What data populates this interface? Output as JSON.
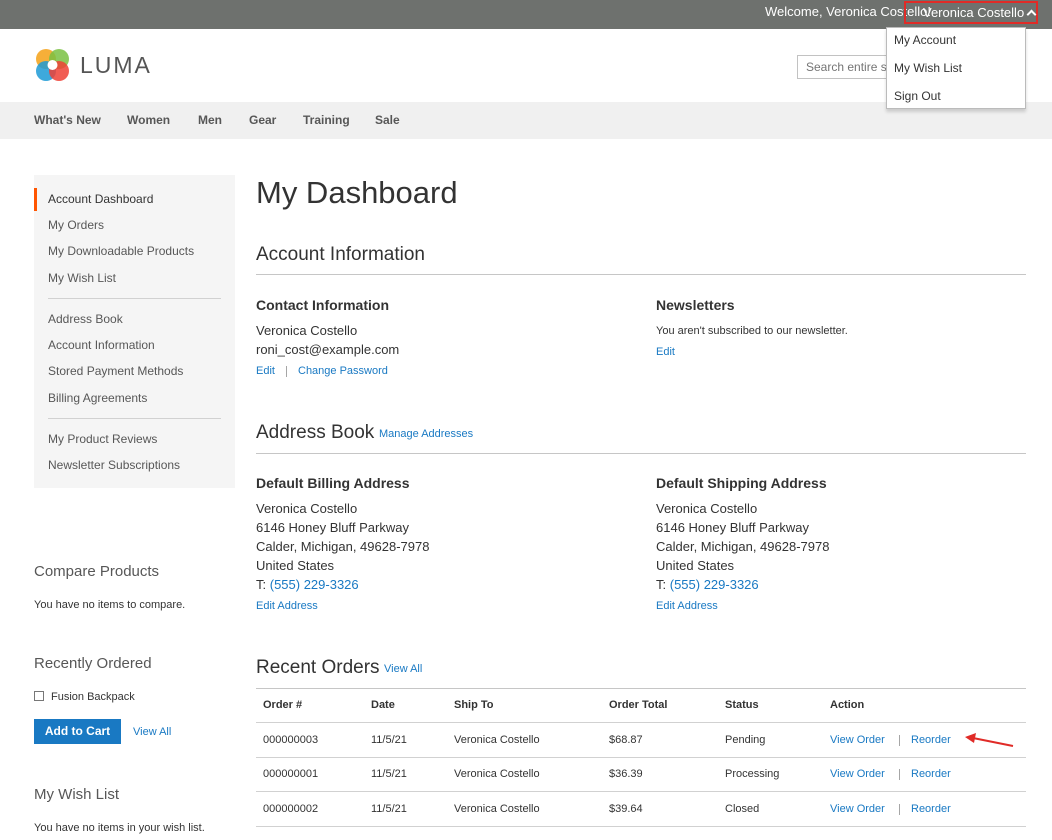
{
  "header": {
    "welcome": "Welcome, Veronica Costello!",
    "customer_name": "Veronica Costello",
    "dropdown": [
      "My Account",
      "My Wish List",
      "Sign Out"
    ],
    "logo_text": "LUMA",
    "search_placeholder": "Search entire store here..."
  },
  "nav": [
    "What's New",
    "Women",
    "Men",
    "Gear",
    "Training",
    "Sale"
  ],
  "sidebar": {
    "items": [
      "Account Dashboard",
      "My Orders",
      "My Downloadable Products",
      "My Wish List",
      "Address Book",
      "Account Information",
      "Stored Payment Methods",
      "Billing Agreements",
      "My Product Reviews",
      "Newsletter Subscriptions"
    ],
    "compare_title": "Compare Products",
    "compare_text": "You have no items to compare.",
    "recent_title": "Recently Ordered",
    "recent_item": "Fusion Backpack",
    "add_to_cart": "Add to Cart",
    "view_all": "View All",
    "wishlist_title": "My Wish List",
    "wishlist_text": "You have no items in your wish list."
  },
  "main": {
    "page_title": "My Dashboard",
    "account_info_title": "Account Information",
    "contact": {
      "title": "Contact Information",
      "name": "Veronica Costello",
      "email": "roni_cost@example.com",
      "edit": "Edit",
      "change_password": "Change Password"
    },
    "newsletters": {
      "title": "Newsletters",
      "text": "You aren't subscribed to our newsletter.",
      "edit": "Edit"
    },
    "address_book_title": "Address Book",
    "manage_addresses": "Manage Addresses",
    "billing": {
      "title": "Default Billing Address",
      "name": "Veronica Costello",
      "street": "6146 Honey Bluff Parkway",
      "city": "Calder, Michigan, 49628-7978",
      "country": "United States",
      "phone_prefix": "T: ",
      "phone": "(555) 229-3326",
      "edit": "Edit Address"
    },
    "shipping": {
      "title": "Default Shipping Address",
      "name": "Veronica Costello",
      "street": "6146 Honey Bluff Parkway",
      "city": "Calder, Michigan, 49628-7978",
      "country": "United States",
      "phone_prefix": "T: ",
      "phone": "(555) 229-3326",
      "edit": "Edit Address"
    },
    "recent_orders_title": "Recent Orders",
    "view_all": "View All",
    "orders": {
      "columns": [
        "Order #",
        "Date",
        "Ship To",
        "Order Total",
        "Status",
        "Action"
      ],
      "view_order": "View Order",
      "reorder": "Reorder",
      "rows": [
        {
          "id": "000000003",
          "date": "11/5/21",
          "ship_to": "Veronica Costello",
          "total": "$68.87",
          "status": "Pending"
        },
        {
          "id": "000000001",
          "date": "11/5/21",
          "ship_to": "Veronica Costello",
          "total": "$36.39",
          "status": "Processing"
        },
        {
          "id": "000000002",
          "date": "11/5/21",
          "ship_to": "Veronica Costello",
          "total": "$39.64",
          "status": "Closed"
        }
      ]
    }
  },
  "colors": {
    "accent": "#1979c3",
    "panel": "#6e716e",
    "highlight": "#e02b27",
    "current_marker": "#ff5501"
  }
}
